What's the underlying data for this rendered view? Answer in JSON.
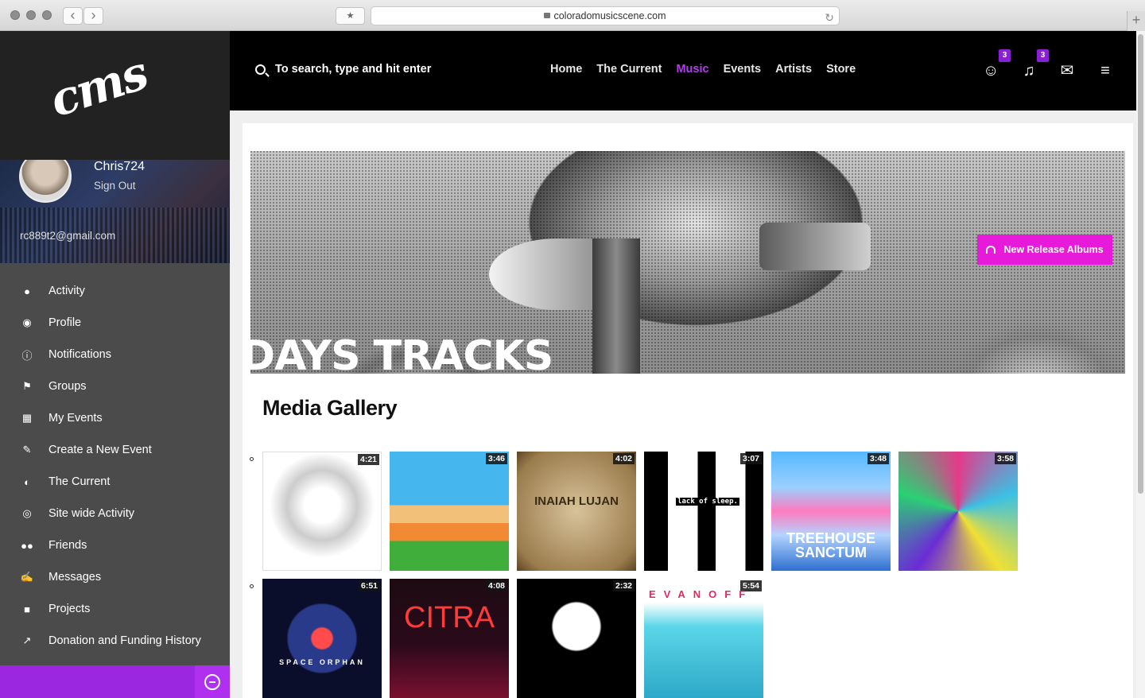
{
  "browser": {
    "url": "coloradomusicscene.com"
  },
  "brand": {
    "logo_text": "cms",
    "accent": "#b33cf2",
    "button_pink": "#e81ad9",
    "footer_purple": "#9b28e0"
  },
  "user": {
    "name": "Chris724",
    "sign_out": "Sign Out",
    "email": "rc889t2@gmail.com"
  },
  "sidebar": {
    "items": [
      {
        "label": "Activity",
        "icon": "user-icon"
      },
      {
        "label": "Profile",
        "icon": "palette-icon"
      },
      {
        "label": "Notifications",
        "icon": "info-icon"
      },
      {
        "label": "Groups",
        "icon": "flag-icon"
      },
      {
        "label": "My Events",
        "icon": "calendar-icon"
      },
      {
        "label": "Create a New Event",
        "icon": "create-event-icon"
      },
      {
        "label": "The Current",
        "icon": "globe-icon"
      },
      {
        "label": "Site wide Activity",
        "icon": "eye-icon"
      },
      {
        "label": "Friends",
        "icon": "friends-icon"
      },
      {
        "label": "Messages",
        "icon": "edit-icon"
      },
      {
        "label": "Projects",
        "icon": "folder-icon"
      },
      {
        "label": "Donation and Funding History",
        "icon": "chart-icon"
      }
    ]
  },
  "header": {
    "search_placeholder": "To search, type and hit enter",
    "nav": [
      "Home",
      "The Current",
      "Music",
      "Events",
      "Artists",
      "Store"
    ],
    "active_nav": "Music",
    "friend_requests_count": "3",
    "notifications_count": "3"
  },
  "hero": {
    "text": "DAYS TRACKS",
    "button_label": "New Release Albums"
  },
  "gallery": {
    "title": "Media Gallery",
    "row1": [
      {
        "duration": "4:21"
      },
      {
        "duration": "3:46"
      },
      {
        "duration": "4:02",
        "text": "INAIAH LUJAN"
      },
      {
        "duration": "3:07",
        "text": "lack of sleep."
      },
      {
        "duration": "3:48",
        "text": "TREEHOUSE SANCTUM"
      },
      {
        "duration": "3:58"
      }
    ],
    "row2": [
      {
        "duration": "6:51",
        "text": "SPACE ORPHAN"
      },
      {
        "duration": "4:08",
        "text": "CITRA"
      },
      {
        "duration": "2:32"
      },
      {
        "duration": "5:54",
        "text": "EVANOFF"
      }
    ]
  }
}
